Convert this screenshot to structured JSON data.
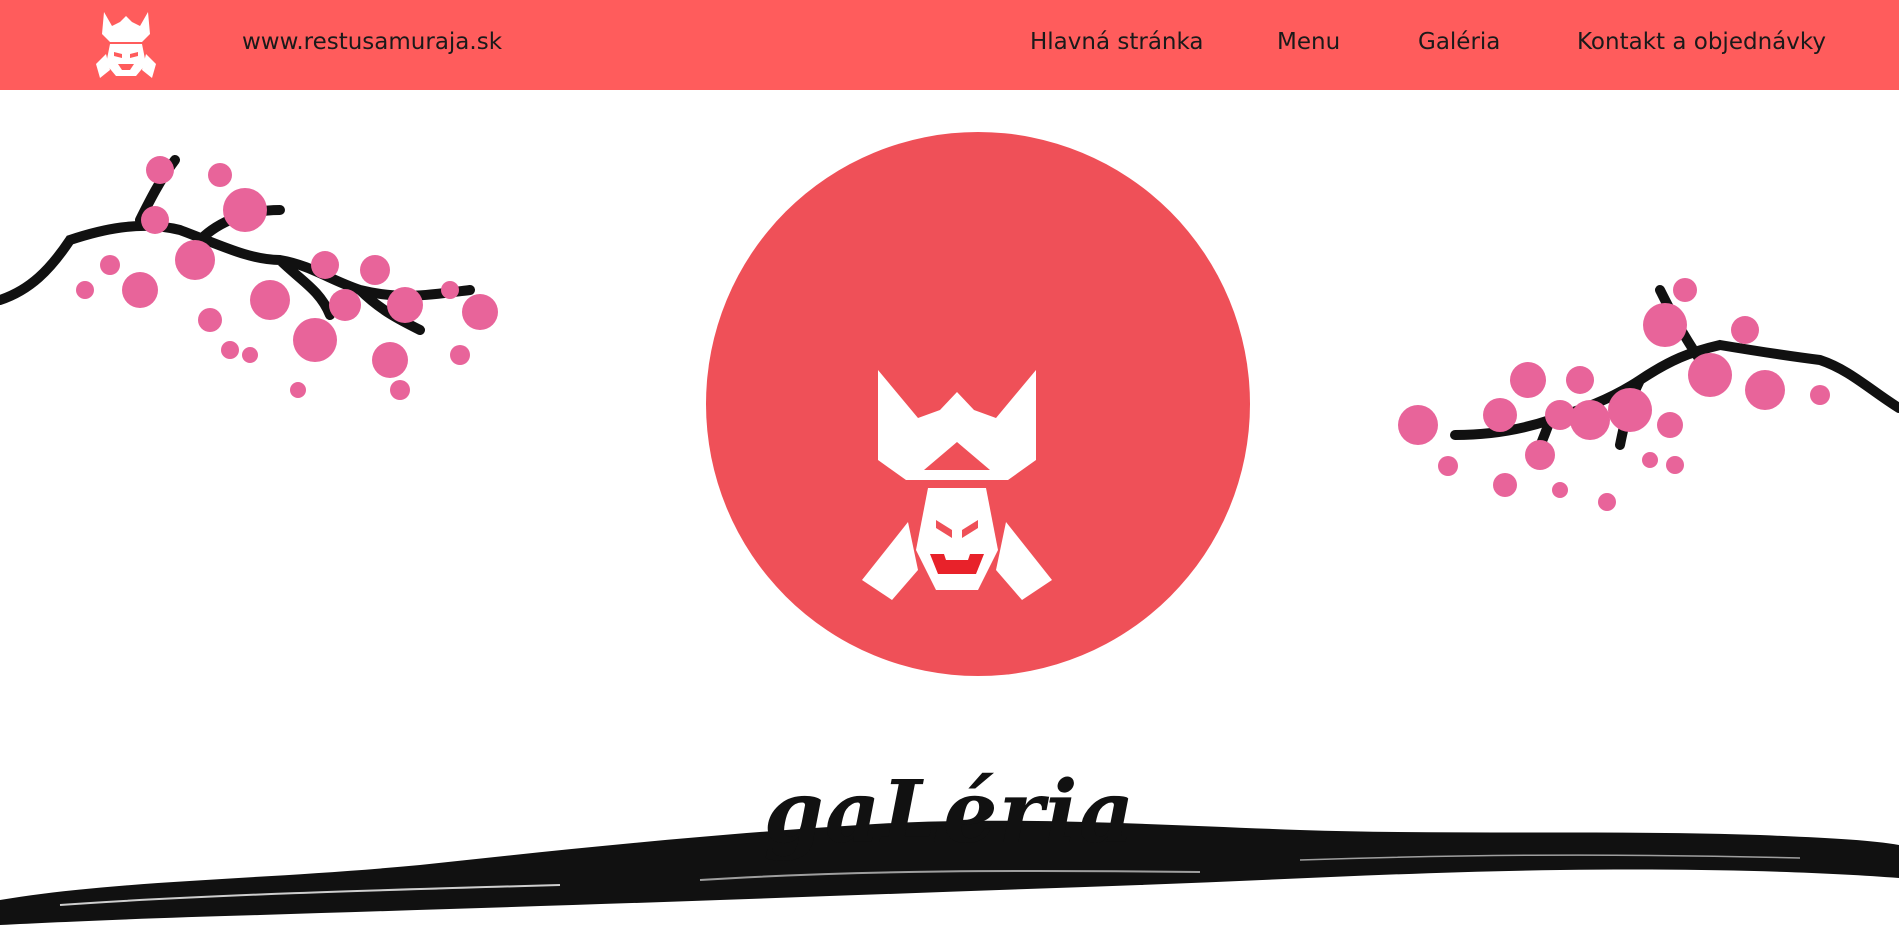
{
  "header": {
    "site_url": "www.restusamuraja.sk",
    "nav": [
      {
        "label": "Hlavná stránka"
      },
      {
        "label": "Menu"
      },
      {
        "label": "Galéria"
      },
      {
        "label": "Kontakt a objednávky"
      }
    ]
  },
  "hero": {
    "title": "gaLéria"
  },
  "colors": {
    "header_bg": "#ff5c5c",
    "sun": "#ef5058",
    "blossom": "#e8649a",
    "branch": "#111111",
    "mouth": "#e8222a"
  },
  "icons": [
    "samurai-helmet-icon",
    "cherry-blossom-branch",
    "ink-brush-stroke"
  ]
}
